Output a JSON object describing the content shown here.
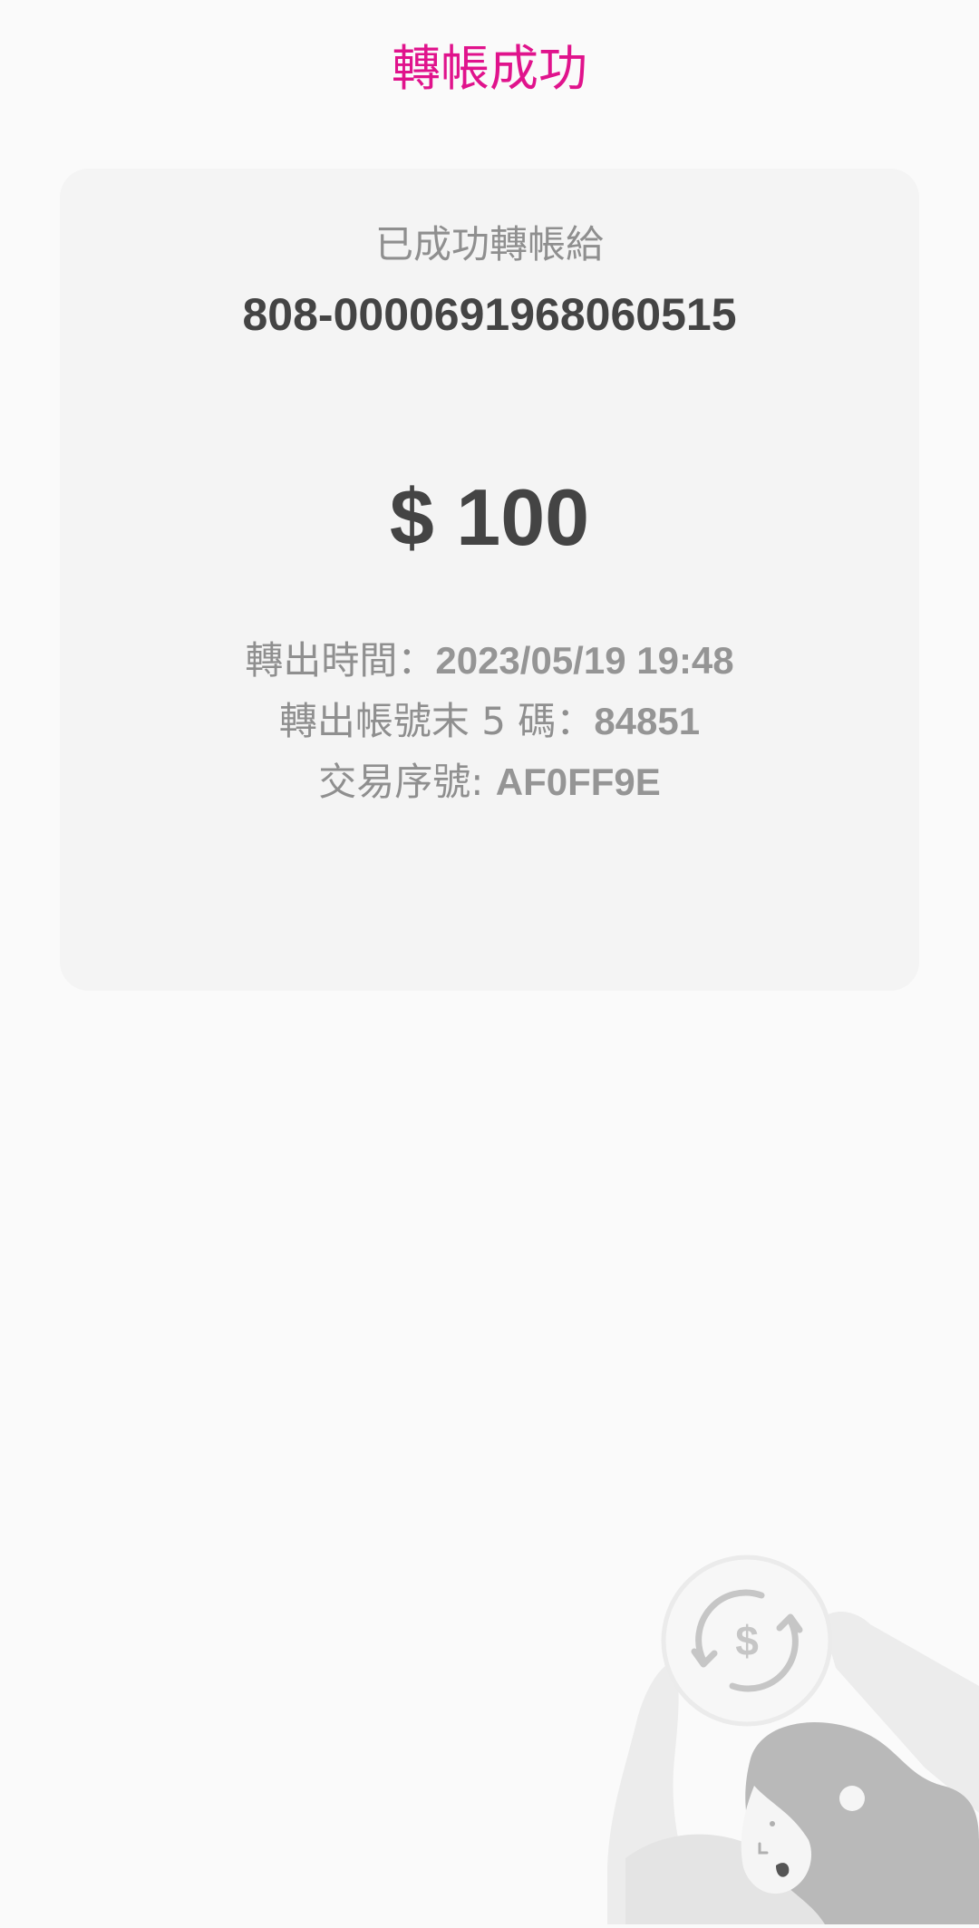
{
  "header": {
    "title": "轉帳成功"
  },
  "receipt": {
    "recipient_label": "已成功轉帳給",
    "recipient_account": "808-0000691968060515",
    "amount": "$ 100",
    "transfer_time_label": "轉出時間：",
    "transfer_time_value": "2023/05/19 19:48",
    "source_last5_label": "轉出帳號末 5 碼：",
    "source_last5_value": "84851",
    "transaction_id_label": "交易序號: ",
    "transaction_id_value": "AF0FF9E"
  },
  "illustration": {
    "icon": "dollar-exchange-icon"
  },
  "colors": {
    "accent": "#e0138c",
    "card_background": "#f4f4f4",
    "page_background": "#fafafa",
    "primary_text": "#444444",
    "secondary_text": "#8f8f8f"
  }
}
